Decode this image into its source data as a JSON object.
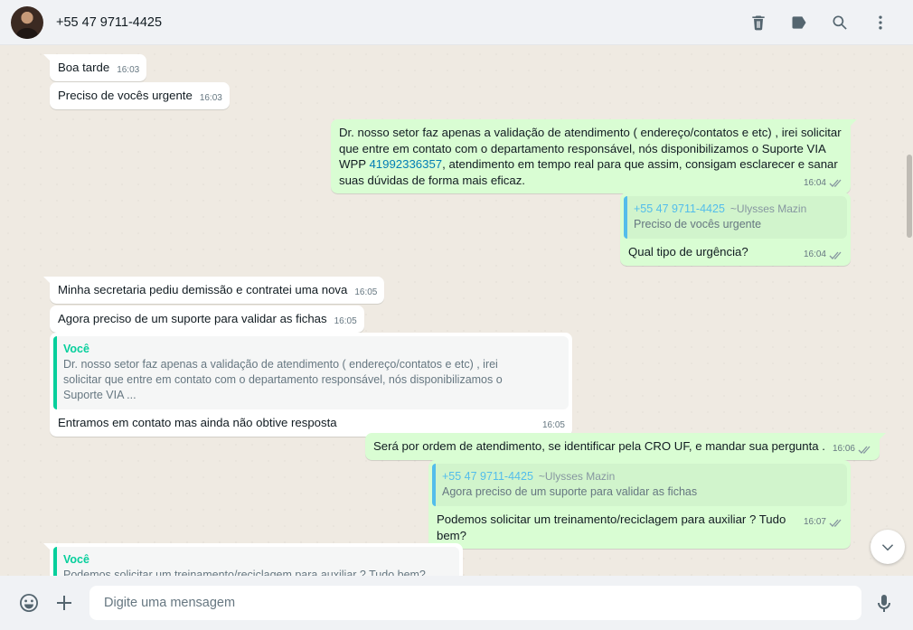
{
  "header": {
    "contact_name": "+55 47 9711-4425",
    "actions": [
      "delete-icon",
      "label-icon",
      "search-icon",
      "menu-icon"
    ]
  },
  "messages": [
    {
      "direction": "in",
      "text": "Boa tarde",
      "time": "16:03"
    },
    {
      "direction": "in",
      "text": "Preciso de vocês urgente",
      "time": "16:03"
    },
    {
      "direction": "out",
      "text_before_link": "Dr. nosso setor faz apenas a validação de atendimento ( endereço/contatos e etc) , irei solicitar que entre em contato com o departamento responsável, nós disponibilizamos o Suporte VIA WPP ",
      "link": "41992336357",
      "text_after_link": ", atendimento em tempo real para que assim, consigam esclarecer e sanar suas dúvidas de forma mais eficaz.",
      "time": "16:04"
    },
    {
      "direction": "out",
      "quote_author": "+55 47 9711-4425",
      "quote_subname": "~Ulysses Mazin",
      "quote_text": "Preciso de vocês urgente",
      "text": "Qual tipo de urgência?",
      "time": "16:04"
    },
    {
      "direction": "in",
      "text": "Minha secretaria pediu demissão e contratei uma nova",
      "time": "16:05"
    },
    {
      "direction": "in",
      "text": "Agora preciso de um suporte para validar as fichas",
      "time": "16:05"
    },
    {
      "direction": "in",
      "quote_author": "Você",
      "quote_text": "Dr. nosso setor faz apenas a validação de atendimento ( endereço/contatos e etc) , irei solicitar que entre em contato com o departamento responsável, nós disponibilizamos o Suporte VIA ...",
      "text": "Entramos em contato mas ainda não obtive resposta",
      "time": "16:05"
    },
    {
      "direction": "out",
      "text": "Será por ordem de atendimento, se identificar pela CRO UF, e mandar sua pergunta .",
      "time": "16:06"
    },
    {
      "direction": "out",
      "quote_author": "+55 47 9711-4425",
      "quote_subname": "~Ulysses Mazin",
      "quote_text": "Agora preciso de um suporte para validar as fichas",
      "text": "Podemos solicitar um treinamento/reciclagem para auxiliar ? Tudo bem?",
      "time": "16:07"
    },
    {
      "direction": "in",
      "quote_author": "Você",
      "quote_text": "Podemos solicitar um treinamento/reciclagem para auxiliar ? Tudo bem?"
    }
  ],
  "footer": {
    "placeholder": "Digite uma mensagem"
  },
  "colors": {
    "incoming": "#ffffff",
    "outgoing": "#d9fdd3",
    "background": "#efeae2",
    "link": "#027eb5",
    "quote_self": "#06cf9c",
    "quote_other": "#53bdeb"
  }
}
